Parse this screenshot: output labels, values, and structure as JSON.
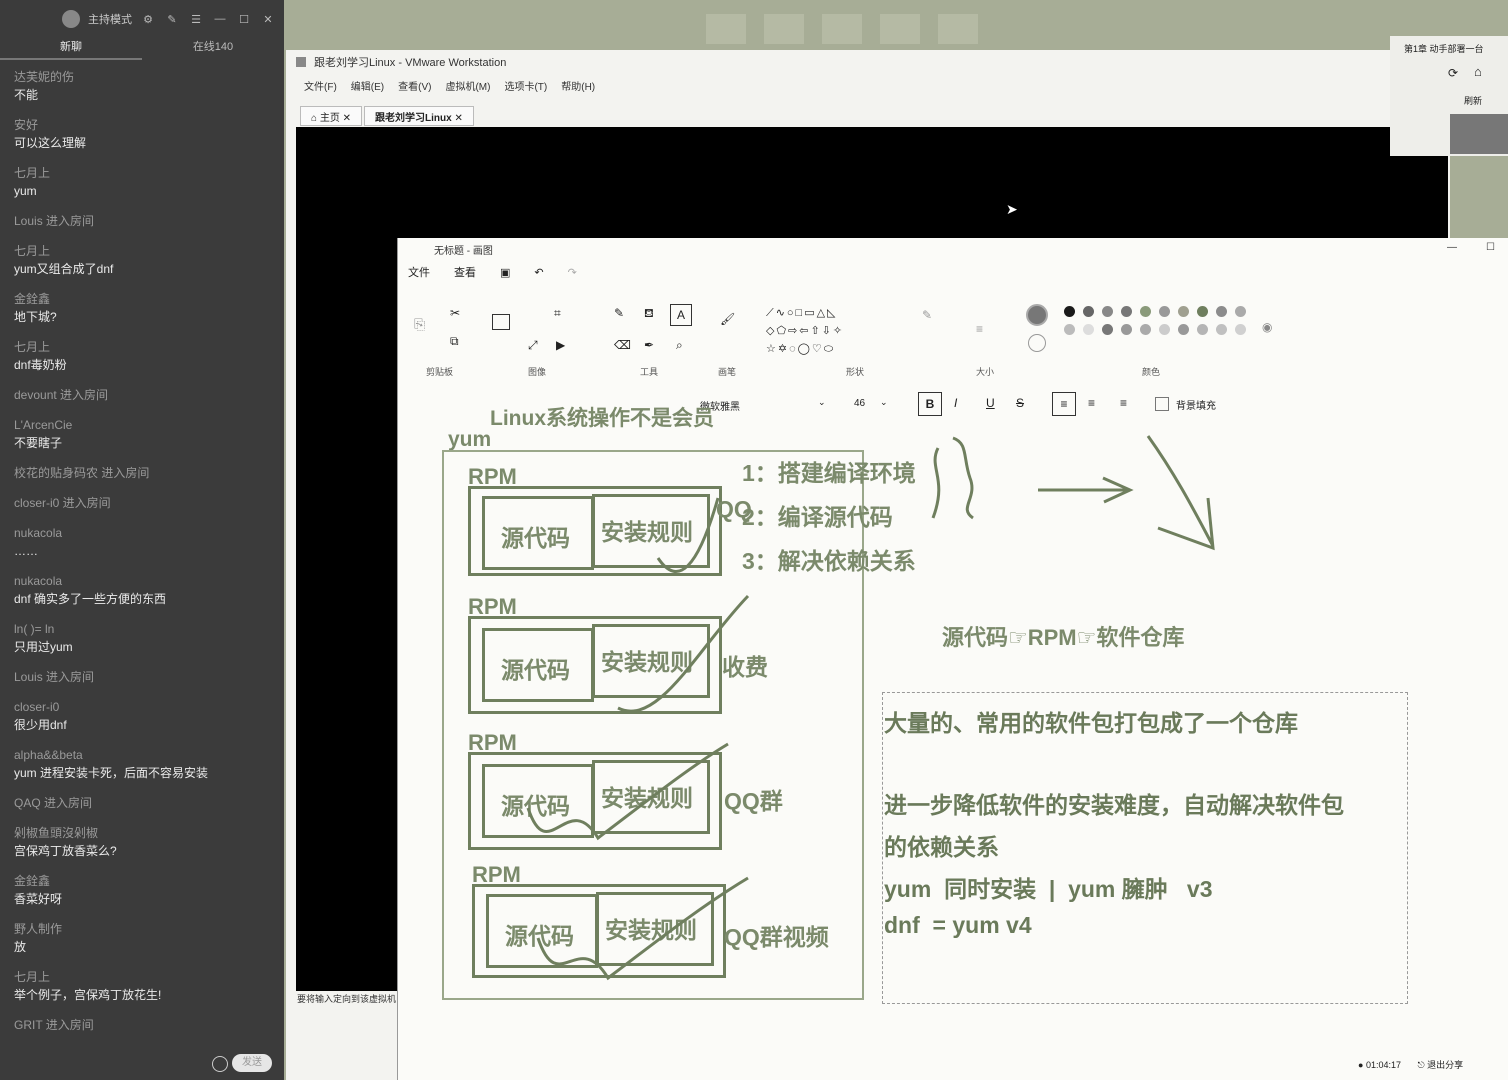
{
  "chat": {
    "mode_label": "主持模式",
    "tabs": [
      "新聊",
      "在线140"
    ],
    "messages": [
      {
        "user": "达芙妮的伤",
        "text": "不能"
      },
      {
        "user": "安好",
        "text": "可以这么理解"
      },
      {
        "user": "七月上",
        "text": "yum"
      },
      {
        "system": "Louis 进入房间"
      },
      {
        "user": "七月上",
        "text": "yum又组合成了dnf"
      },
      {
        "user": "金銓鑫",
        "text": "地下城?"
      },
      {
        "user": "七月上",
        "text": "dnf毒奶粉"
      },
      {
        "system": "devount 进入房间"
      },
      {
        "user": "L'ArcenCie",
        "text": "不要瞎子"
      },
      {
        "system": "校花的贴身码农 进入房间"
      },
      {
        "system": "closer-i0     进入房间"
      },
      {
        "user": "nukacola",
        "text": "……"
      },
      {
        "user": "nukacola",
        "text": "dnf 确实多了一些方便的东西"
      },
      {
        "user": "ln(    )=     ln",
        "text": "只用过yum"
      },
      {
        "system": "Louis 进入房间"
      },
      {
        "user": "closer-i0",
        "text": "很少用dnf"
      },
      {
        "user": "alpha&&beta",
        "text": "yum 进程安装卡死，后面不容易安装"
      },
      {
        "system": "QAQ 进入房间"
      },
      {
        "user": "剁椒鱼頭沒剁椒",
        "text": "宫保鸡丁放香菜么?"
      },
      {
        "user": "金銓鑫",
        "text": "香菜好呀"
      },
      {
        "user": "野人制作",
        "text": "放"
      },
      {
        "user": "七月上",
        "text": "举个例子，宫保鸡丁放花生!"
      },
      {
        "system": "GRIT 进入房间"
      }
    ],
    "send_label": "发送"
  },
  "vmware": {
    "title": "跟老刘学习Linux - VMware Workstation",
    "menu": [
      "文件(F)",
      "编辑(E)",
      "查看(V)",
      "虚拟机(M)",
      "选项卡(T)",
      "帮助(H)"
    ],
    "tabs": [
      "主页",
      "跟老刘学习Linux"
    ],
    "status_hint": "要将输入定向到该虚拟机"
  },
  "paint": {
    "title": "无标题 - 画图",
    "menu": [
      "文件",
      "查看"
    ],
    "groups": [
      "剪贴板",
      "图像",
      "工具",
      "画笔",
      "形状",
      "大小",
      "颜色"
    ],
    "font_name": "微软雅黑",
    "font_size": "46",
    "fill_label": "背景填充",
    "palette": [
      "#1a1a1a",
      "#666666",
      "#888888",
      "#777777",
      "#8a9a7a",
      "#999999",
      "#a0a090",
      "#6f7f5e",
      "#8c8c8c",
      "#aaaaaa",
      "#bbbbbb",
      "#dddddd",
      "#777777",
      "#999999",
      "#aaaaaa",
      "#cccccc",
      "#999999",
      "#b5b5b5",
      "#c0c0c0",
      "#d0d0d0"
    ],
    "accent_color": "#6f7f5e"
  },
  "canvas": {
    "heading": "Linux系统操作不是会员",
    "yum_label": "yum",
    "rpm_label": "RPM",
    "source_label": "源代码",
    "rules_label": "安装规则",
    "qq_label": "QQ",
    "fee_label": "收费",
    "qqgroup_label": "QQ群",
    "qqvideo_label": "QQ群视频",
    "steps": [
      "1：搭建编译环境",
      "2：编译源代码",
      "3：解决依赖关系"
    ],
    "flow": "源代码☞RPM☞软件仓库",
    "notes": [
      "大量的、常用的软件包打包成了一个仓库",
      "进一步降低软件的安装难度，自动解决软件包",
      "的依赖关系",
      "yum  同时安装  |  yum 臃肿   v3",
      "dnf  = yum v4"
    ]
  },
  "sidebar": {
    "chapter": "第1章 动手部署一台",
    "refresh_label": "刷新"
  },
  "status": {
    "time": "01:04:17",
    "exit_share": "退出分享"
  }
}
